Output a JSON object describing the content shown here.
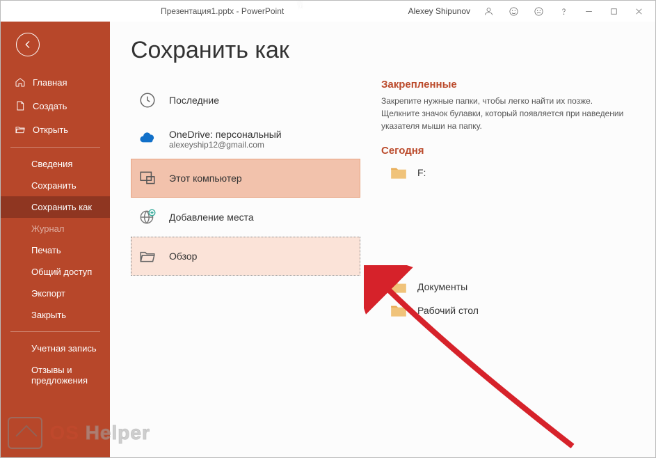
{
  "titlebar": {
    "title": "Презентация1.pptx  -  PowerPoint",
    "user": "Alexey Shipunov"
  },
  "sidebar": {
    "primary": [
      {
        "key": "home",
        "label": "Главная"
      },
      {
        "key": "new",
        "label": "Создать"
      },
      {
        "key": "open",
        "label": "Открыть"
      }
    ],
    "secondary": [
      {
        "key": "info",
        "label": "Сведения"
      },
      {
        "key": "save",
        "label": "Сохранить"
      },
      {
        "key": "saveas",
        "label": "Сохранить как"
      },
      {
        "key": "history",
        "label": "Журнал"
      },
      {
        "key": "print",
        "label": "Печать"
      },
      {
        "key": "share",
        "label": "Общий доступ"
      },
      {
        "key": "export",
        "label": "Экспорт"
      },
      {
        "key": "close",
        "label": "Закрыть"
      }
    ],
    "footer": [
      {
        "key": "account",
        "label": "Учетная запись"
      },
      {
        "key": "feedback",
        "label": "Отзывы и предложения"
      }
    ]
  },
  "page": {
    "title": "Сохранить как"
  },
  "locations": {
    "recent": {
      "label": "Последние"
    },
    "onedrive": {
      "label": "OneDrive: персональный",
      "sub": "alexeyship12@gmail.com"
    },
    "thispc": {
      "label": "Этот компьютер"
    },
    "addplace": {
      "label": "Добавление места"
    },
    "browse": {
      "label": "Обзор"
    }
  },
  "right": {
    "pinned": {
      "head": "Закрепленные",
      "desc": "Закрепите нужные папки, чтобы легко найти их позже. Щелкните значок булавки, который появляется при наведении указателя мыши на папку."
    },
    "today": {
      "head": "Сегодня"
    },
    "folders": [
      {
        "label": "F:"
      },
      {
        "label": "Документы"
      },
      {
        "label": "Рабочий стол"
      }
    ]
  },
  "watermark": {
    "os": "OS",
    "helper": " Helper"
  }
}
